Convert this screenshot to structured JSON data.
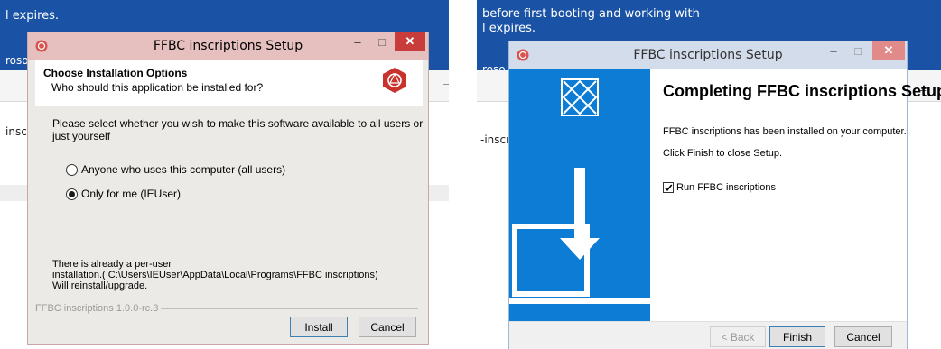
{
  "left": {
    "background": {
      "notice": "l expires.",
      "cut_text": "roso",
      "row_text": "inscri",
      "ctrl_min": "–",
      "ctrl_max": "□"
    },
    "dialog": {
      "title": "FFBC inscriptions Setup",
      "buttons": {
        "minimize": "–",
        "maximize": "□",
        "close": "✕"
      },
      "header_title": "Choose Installation Options",
      "header_subtitle": "Who should this application be installed for?",
      "prompt": "Please select whether you wish to make this software available to all users or just yourself",
      "options": [
        {
          "label": "Anyone who uses this computer (all users)",
          "selected": false
        },
        {
          "label": "Only for me (IEUser)",
          "selected": true
        }
      ],
      "notice_lines": [
        "There is already a per-user",
        "installation.( C:\\Users\\IEUser\\AppData\\Local\\Programs\\FFBC inscriptions)",
        "Will reinstall/upgrade."
      ],
      "brand": "FFBC inscriptions 1.0.0-rc.3",
      "install_button": "Install",
      "cancel_button": "Cancel"
    }
  },
  "right": {
    "background": {
      "notice_line1": "before first booting and working with",
      "notice_line2": "l expires.",
      "cut_text": "roso",
      "row_text": "-inscri",
      "ctrl_min": "–"
    },
    "dialog": {
      "title": "FFBC inscriptions Setup",
      "buttons": {
        "minimize": "–",
        "maximize": "□",
        "close": "✕"
      },
      "heading": "Completing FFBC inscriptions Setup",
      "installed_text": "FFBC inscriptions has been installed on your computer.",
      "finish_hint": "Click Finish to close Setup.",
      "run_checkbox": {
        "label": "Run FFBC inscriptions",
        "checked": true
      },
      "back_button": "< Back",
      "finish_button": "Finish",
      "cancel_button": "Cancel"
    }
  },
  "colors": {
    "background_blue": "#1a53a6",
    "left_titlebar": "#e6bfbf",
    "right_titlebar": "#d2dcea",
    "side_panel": "#0d7cd4",
    "close_red": "#c83c3c",
    "close_pink": "#e08a8a"
  }
}
